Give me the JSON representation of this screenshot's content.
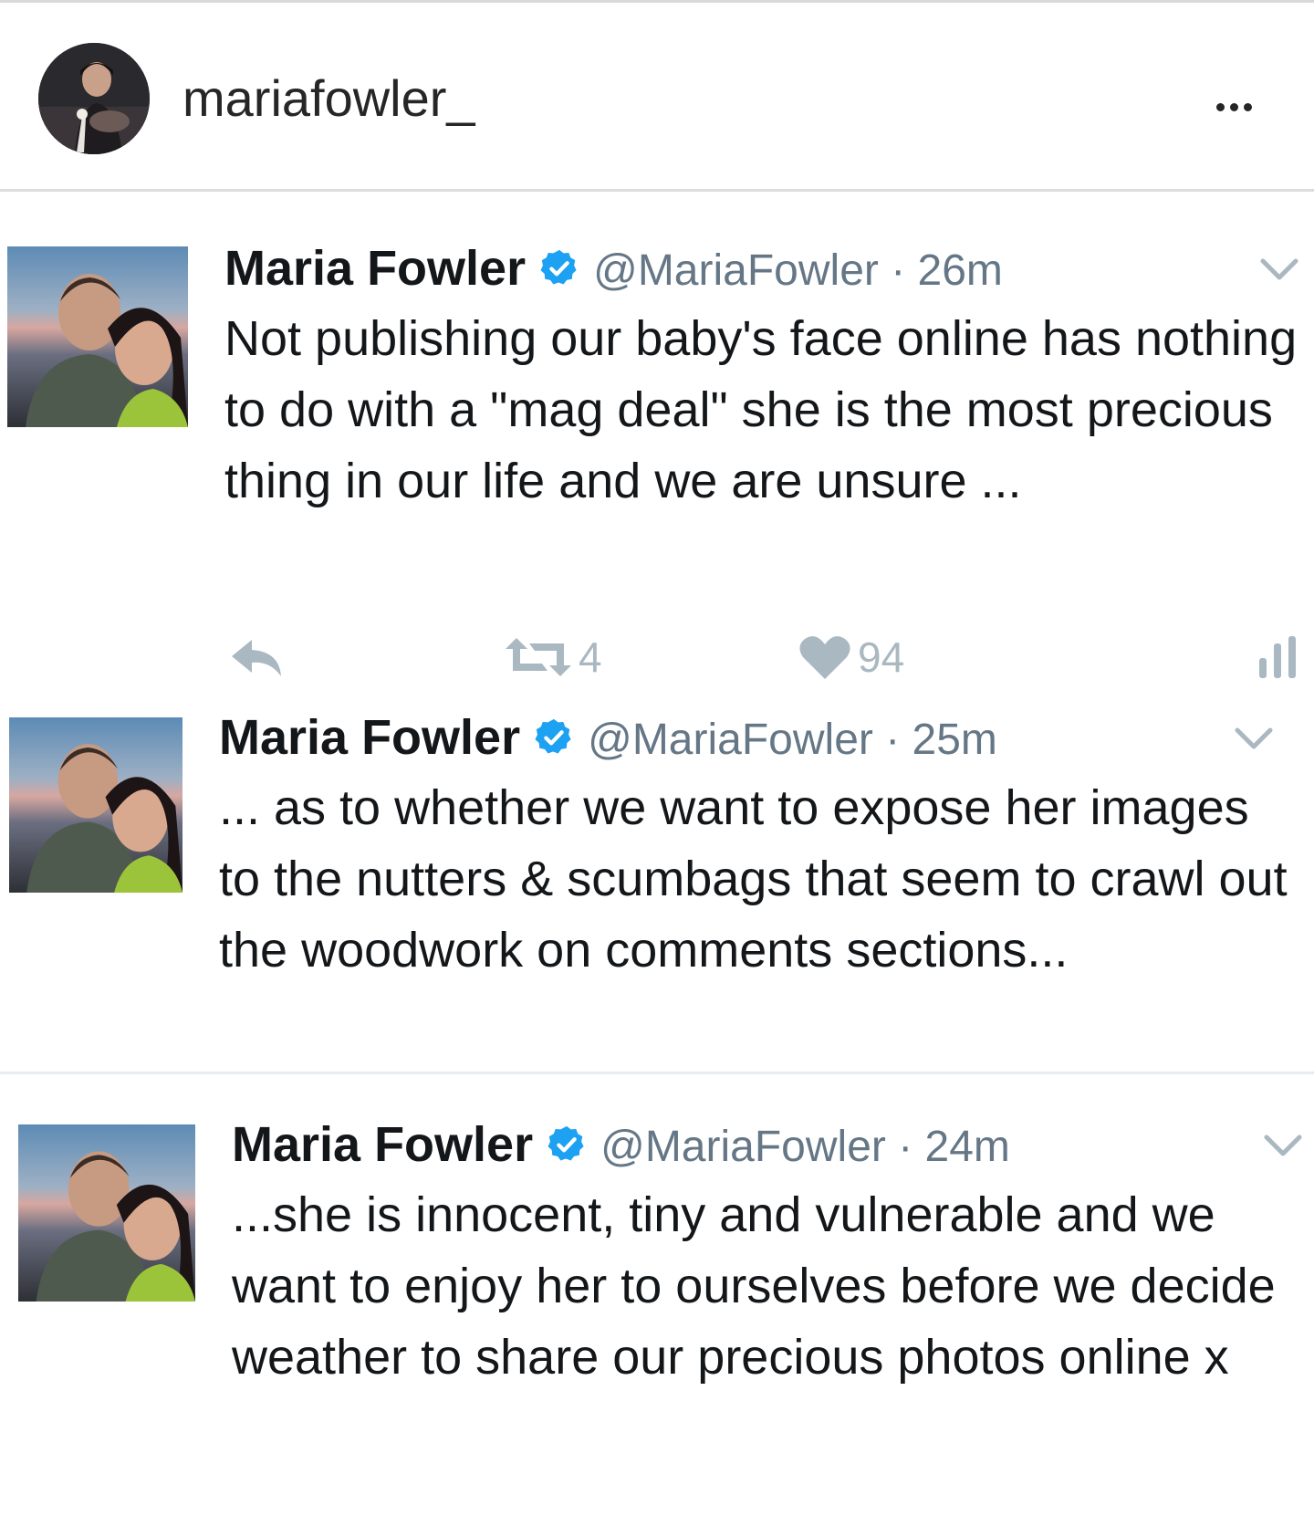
{
  "post": {
    "username": "mariafowler_",
    "more_icon": "more-horizontal-icon"
  },
  "tweets": [
    {
      "name": "Maria Fowler",
      "handle": "@MariaFowler · 26m",
      "text": "Not publishing our baby's face online has nothing to do with a \"mag deal\" she is the most precious thing in our life and we are unsure ...",
      "retweets": "4",
      "likes": "94"
    },
    {
      "name": "Maria Fowler",
      "handle": "@MariaFowler · 25m",
      "text": "... as to whether we want to expose her images to the nutters & scumbags that seem to crawl out the woodwork on comments sections..."
    },
    {
      "name": "Maria Fowler",
      "handle": "@MariaFowler · 24m",
      "text": "...she is innocent, tiny and vulnerable and we want to enjoy her to ourselves before we decide weather to share our precious photos online x"
    }
  ],
  "colors": {
    "verified_blue": "#1da1f2",
    "muted_gray": "#657786",
    "action_gray": "#aab8c2"
  }
}
